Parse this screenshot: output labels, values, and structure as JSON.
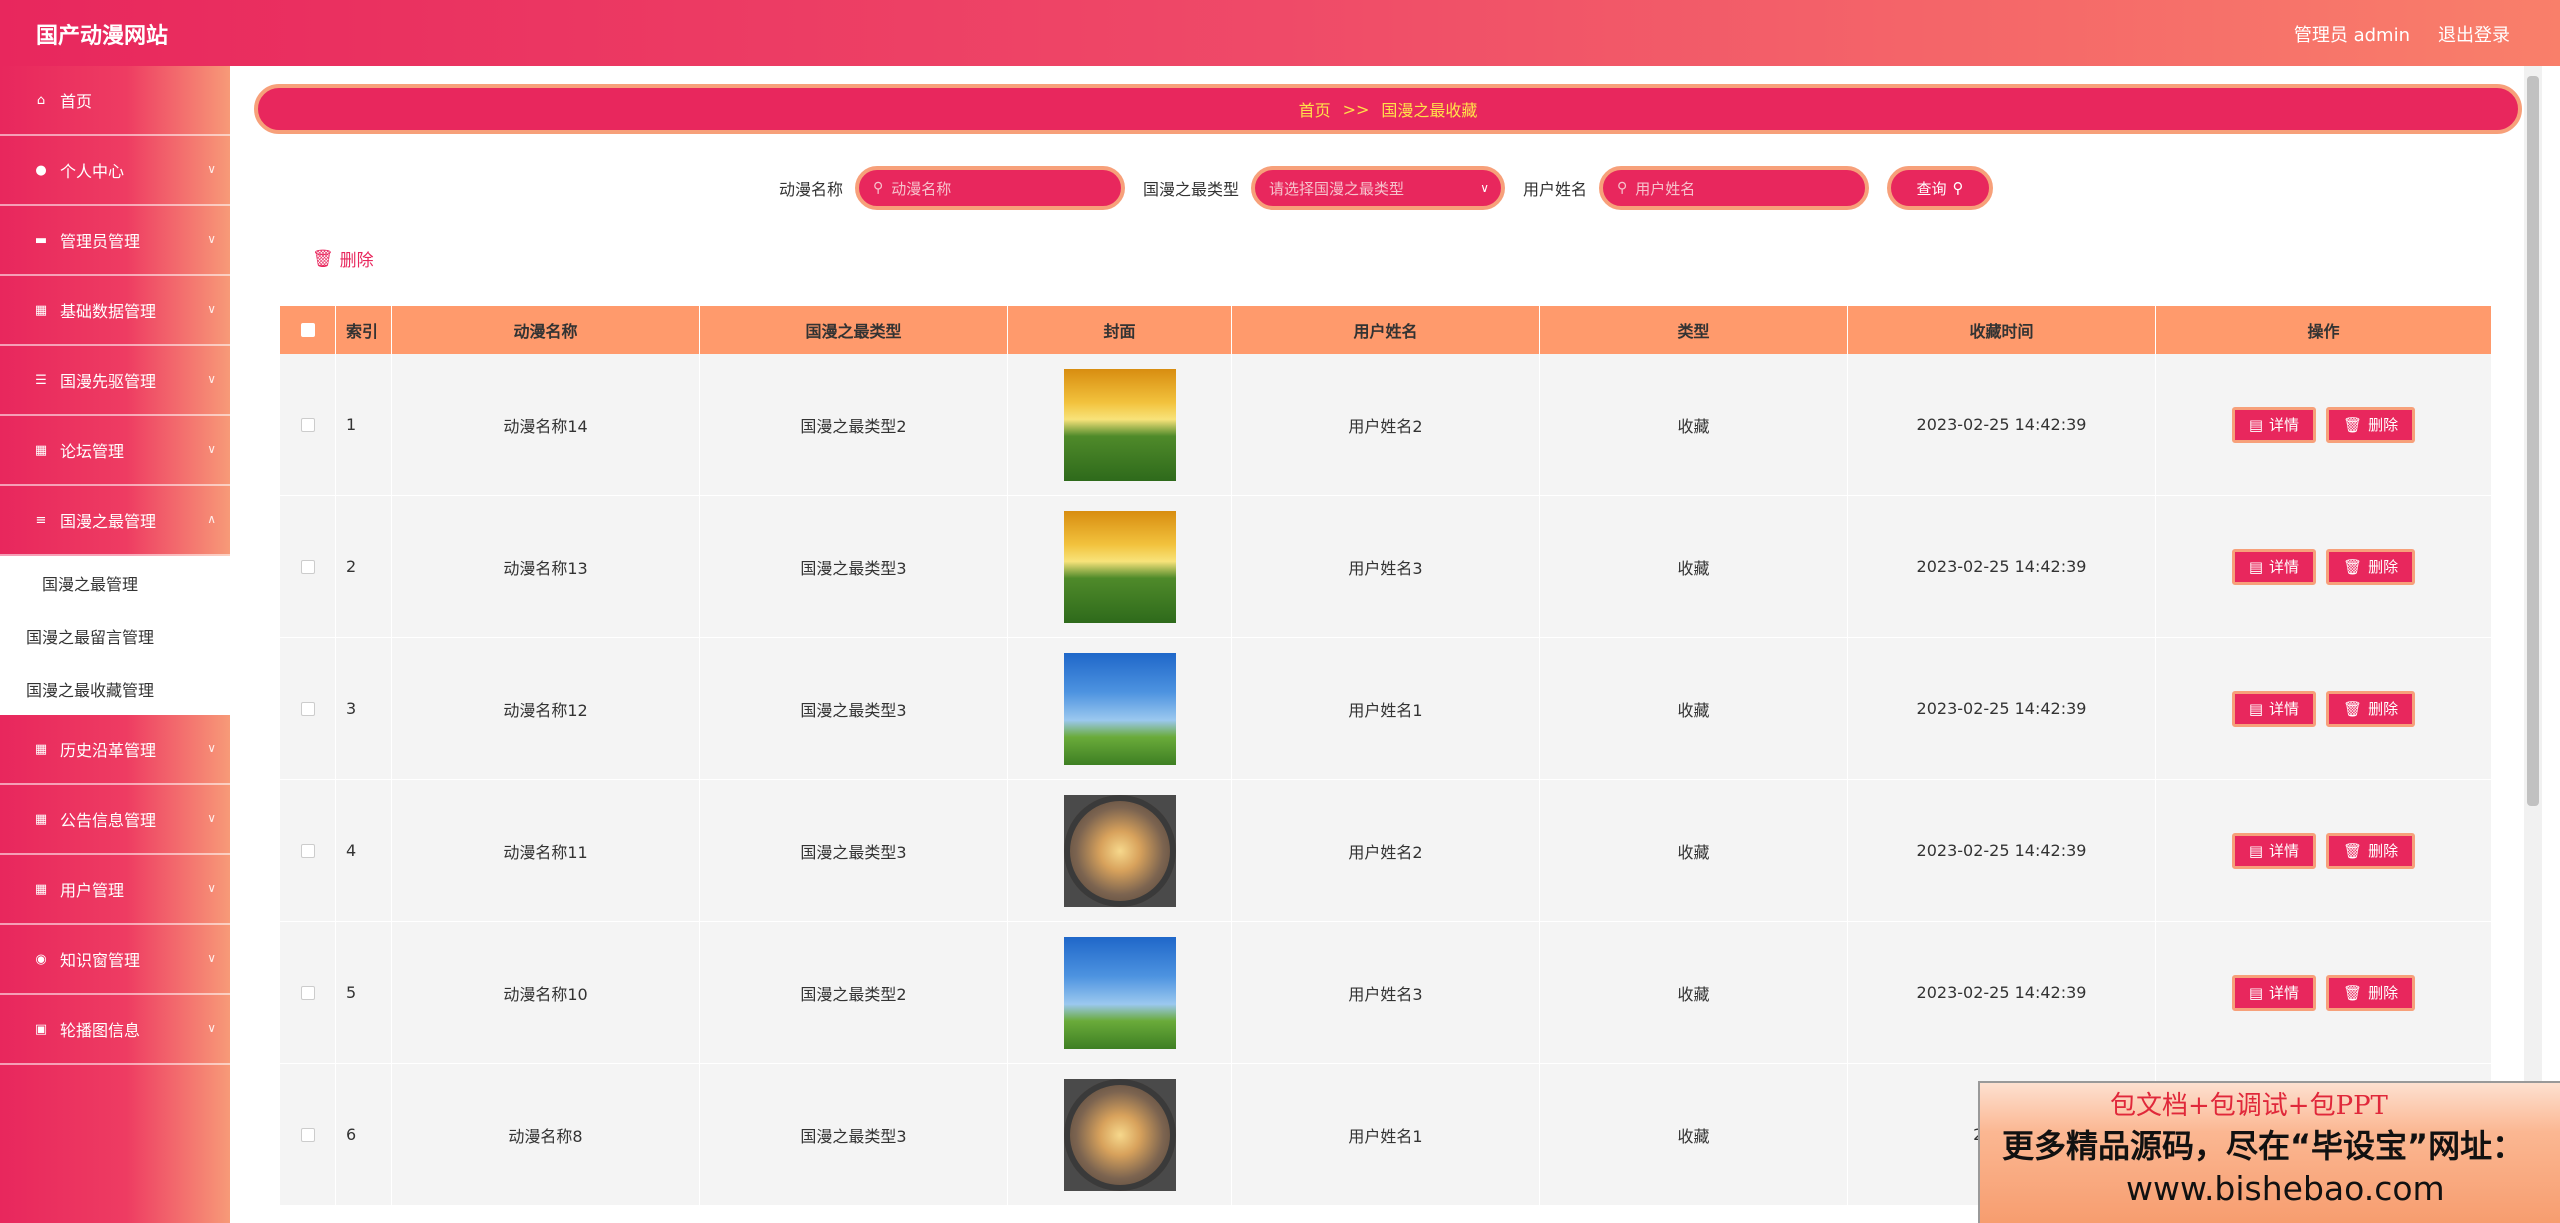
{
  "header": {
    "brand": "国产动漫网站",
    "user_label": "管理员 admin",
    "logout": "退出登录"
  },
  "sidebar": {
    "items": [
      {
        "label": "首页",
        "icon": "home-icon"
      },
      {
        "label": "个人中心",
        "icon": "user-icon"
      },
      {
        "label": "管理员管理",
        "icon": "briefcase-icon"
      },
      {
        "label": "基础数据管理",
        "icon": "grid-icon"
      },
      {
        "label": "国漫先驱管理",
        "icon": "sliders-icon"
      },
      {
        "label": "论坛管理",
        "icon": "grid-icon"
      },
      {
        "label": "国漫之最管理",
        "icon": "list-icon"
      }
    ],
    "submenu": [
      "国漫之最管理",
      "国漫之最留言管理",
      "国漫之最收藏管理"
    ],
    "items_after": [
      {
        "label": "历史沿革管理",
        "icon": "grid-icon"
      },
      {
        "label": "公告信息管理",
        "icon": "grid-icon"
      },
      {
        "label": "用户管理",
        "icon": "grid-icon"
      },
      {
        "label": "知识窗管理",
        "icon": "location-icon"
      },
      {
        "label": "轮播图信息",
        "icon": "picture-icon"
      }
    ]
  },
  "breadcrumb": {
    "home": "首页",
    "sep": ">>",
    "current": "国漫之最收藏"
  },
  "search": {
    "name_label": "动漫名称",
    "name_placeholder": "动漫名称",
    "type_label": "国漫之最类型",
    "type_placeholder": "请选择国漫之最类型",
    "user_label": "用户姓名",
    "user_placeholder": "用户姓名",
    "query": "查询"
  },
  "delete_label": "删除",
  "table": {
    "headers": [
      "索引",
      "动漫名称",
      "国漫之最类型",
      "封面",
      "用户姓名",
      "类型",
      "收藏时间",
      "操作"
    ],
    "detail_label": "详情",
    "delete_label": "删除",
    "rows": [
      {
        "idx": "1",
        "name": "动漫名称14",
        "type": "国漫之最类型2",
        "cover": "sunflower",
        "user": "用户姓名2",
        "kind": "收藏",
        "time": "2023-02-25 14:42:39"
      },
      {
        "idx": "2",
        "name": "动漫名称13",
        "type": "国漫之最类型3",
        "cover": "sunflower",
        "user": "用户姓名3",
        "kind": "收藏",
        "time": "2023-02-25 14:42:39"
      },
      {
        "idx": "3",
        "name": "动漫名称12",
        "type": "国漫之最类型3",
        "cover": "sky",
        "user": "用户姓名1",
        "kind": "收藏",
        "time": "2023-02-25 14:42:39"
      },
      {
        "idx": "4",
        "name": "动漫名称11",
        "type": "国漫之最类型3",
        "cover": "sunset",
        "user": "用户姓名2",
        "kind": "收藏",
        "time": "2023-02-25 14:42:39"
      },
      {
        "idx": "5",
        "name": "动漫名称10",
        "type": "国漫之最类型2",
        "cover": "sky",
        "user": "用户姓名3",
        "kind": "收藏",
        "time": "2023-02-25 14:42:39"
      },
      {
        "idx": "6",
        "name": "动漫名称8",
        "type": "国漫之最类型3",
        "cover": "sunset",
        "user": "用户姓名1",
        "kind": "收藏",
        "time": "2023-0"
      }
    ]
  },
  "promo": {
    "line1": "包文档+包调试+包PPT",
    "line2": "更多精品源码，尽在“毕设宝”网址：",
    "line3": "www.bishebao.com"
  },
  "colors": {
    "accent": "#e8275d",
    "header_row": "#ff9a6c",
    "border": "#f7a07a"
  }
}
